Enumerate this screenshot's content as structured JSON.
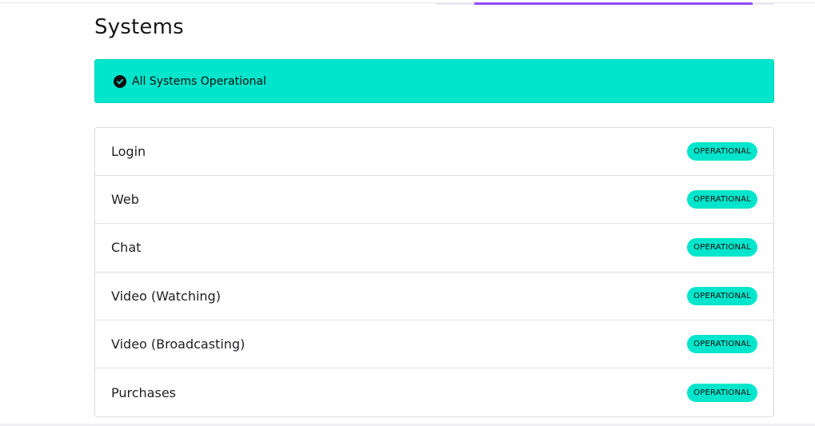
{
  "page": {
    "title": "Systems"
  },
  "banner": {
    "icon": "check-circle-icon",
    "text": "All Systems Operational",
    "color": "#00e5cb"
  },
  "systems": [
    {
      "name": "Login",
      "status": "OPERATIONAL"
    },
    {
      "name": "Web",
      "status": "OPERATIONAL"
    },
    {
      "name": "Chat",
      "status": "OPERATIONAL"
    },
    {
      "name": "Video (Watching)",
      "status": "OPERATIONAL"
    },
    {
      "name": "Video (Broadcasting)",
      "status": "OPERATIONAL"
    },
    {
      "name": "Purchases",
      "status": "OPERATIONAL"
    }
  ],
  "colors": {
    "accent": "#9147ff",
    "operational": "#00e5cb",
    "text": "#1f1f23"
  }
}
